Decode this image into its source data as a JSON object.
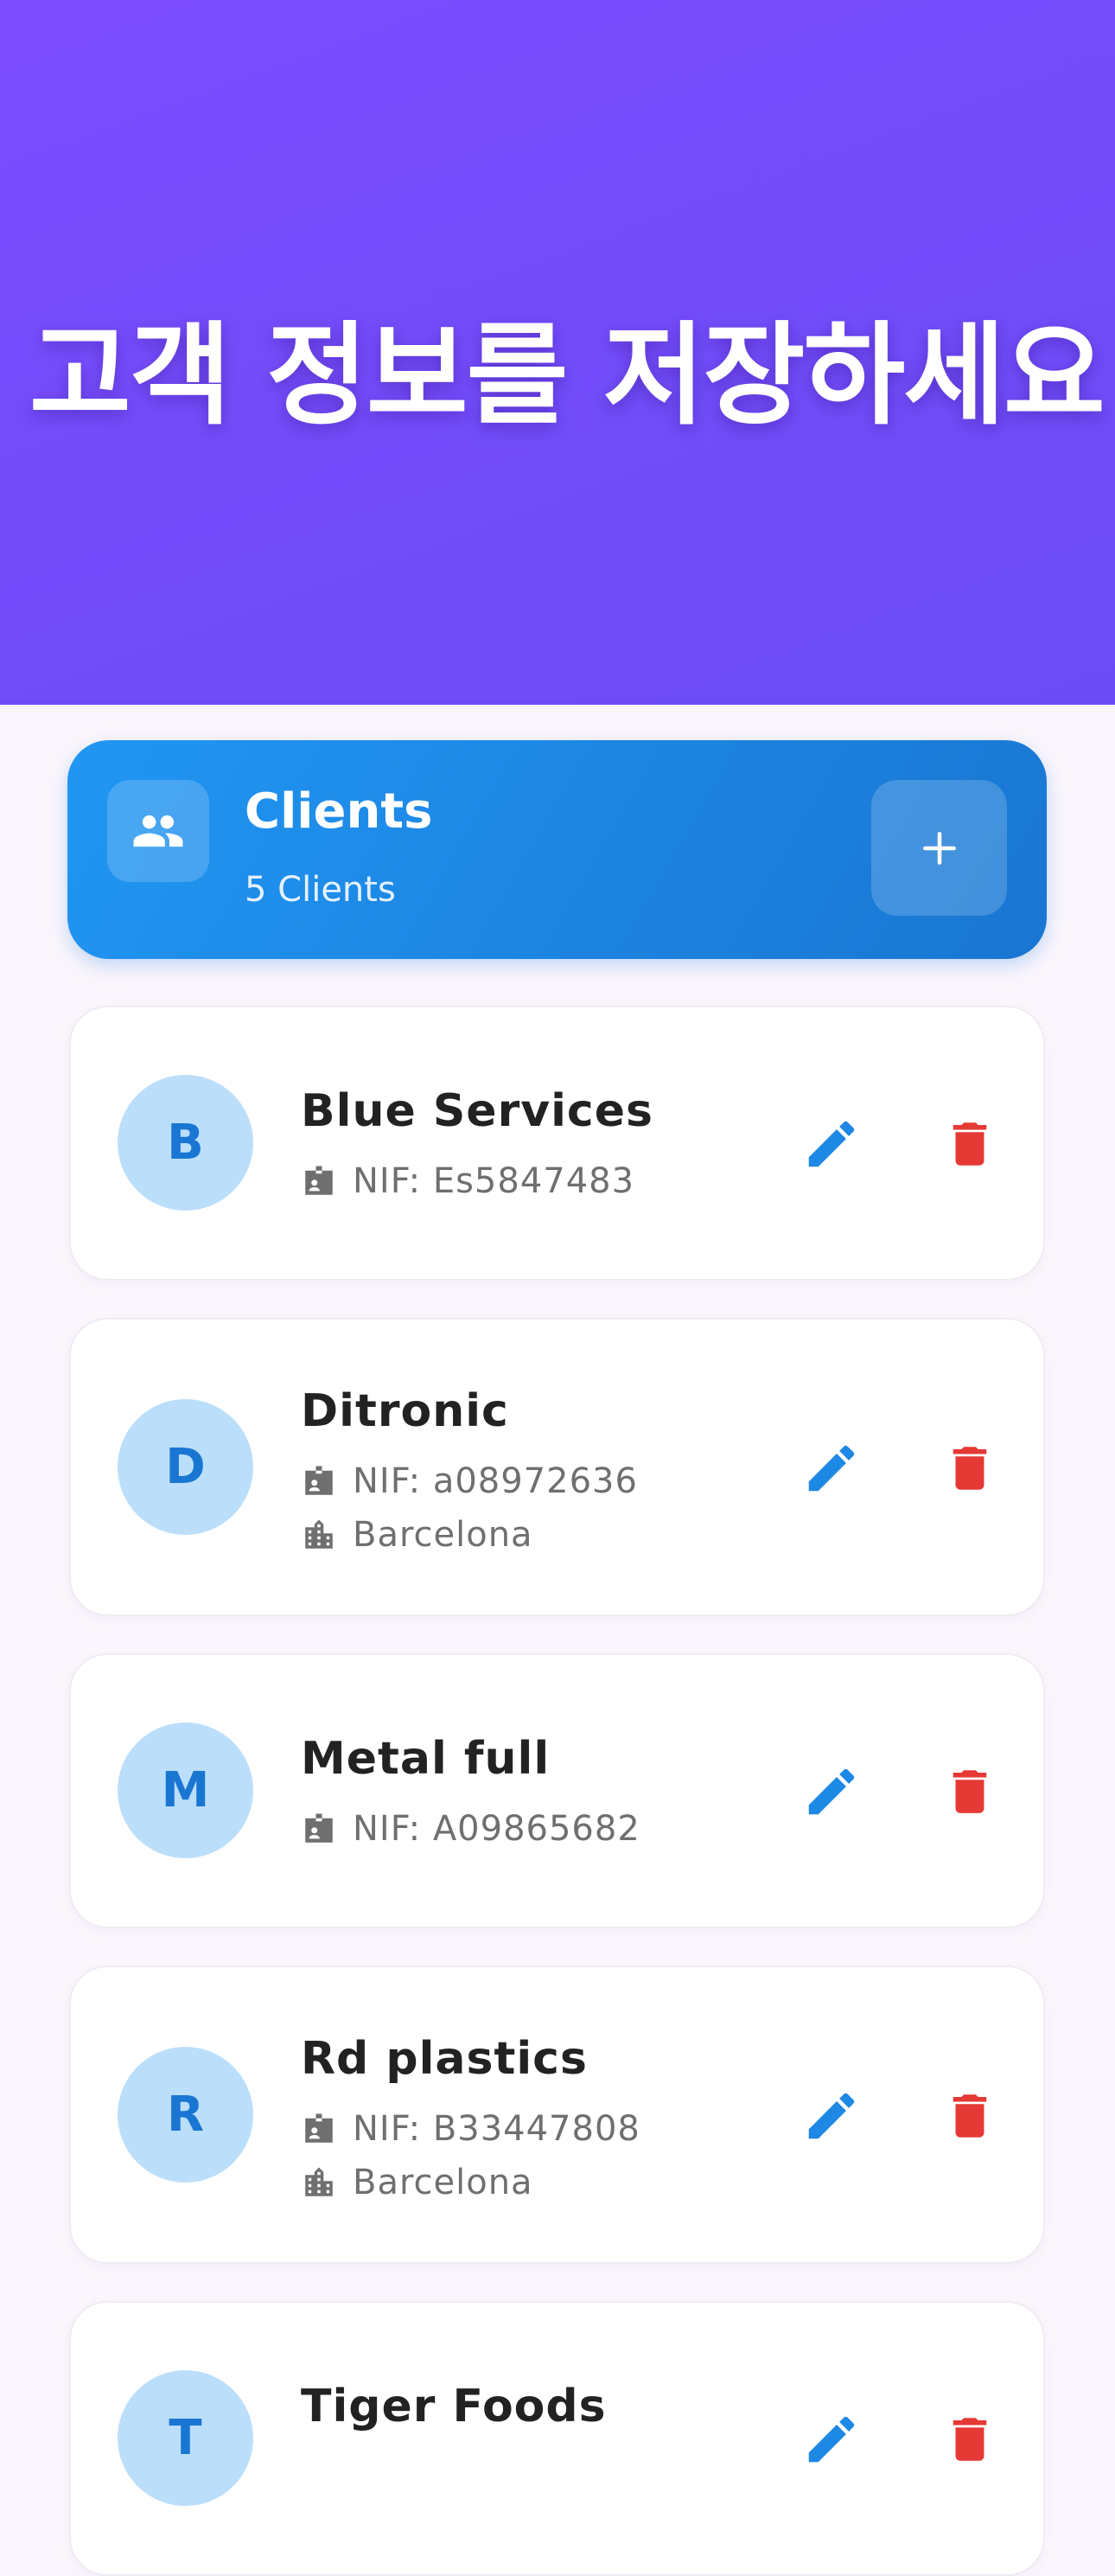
{
  "banner": {
    "title": "고객 정보를 저장하세요"
  },
  "header": {
    "title": "Clients",
    "count": "5 Clients",
    "icon": "people-icon",
    "add_icon": "plus-icon"
  },
  "clients": [
    {
      "initial": "B",
      "name": "Blue Services",
      "nif": "NIF: Es5847483",
      "city": ""
    },
    {
      "initial": "D",
      "name": "Ditronic",
      "nif": "NIF: a08972636",
      "city": "Barcelona"
    },
    {
      "initial": "M",
      "name": "Metal full",
      "nif": "NIF: A09865682",
      "city": ""
    },
    {
      "initial": "R",
      "name": "Rd plastics",
      "nif": "NIF: B33447808",
      "city": "Barcelona"
    },
    {
      "initial": "T",
      "name": "Tiger Foods",
      "nif": "",
      "city": ""
    }
  ],
  "colors": {
    "banner": "#7c4dff",
    "header_card": "#2196f3",
    "avatar_bg": "#bbdefb",
    "avatar_text": "#1976d2",
    "edit": "#1e88e5",
    "delete": "#e53935"
  }
}
